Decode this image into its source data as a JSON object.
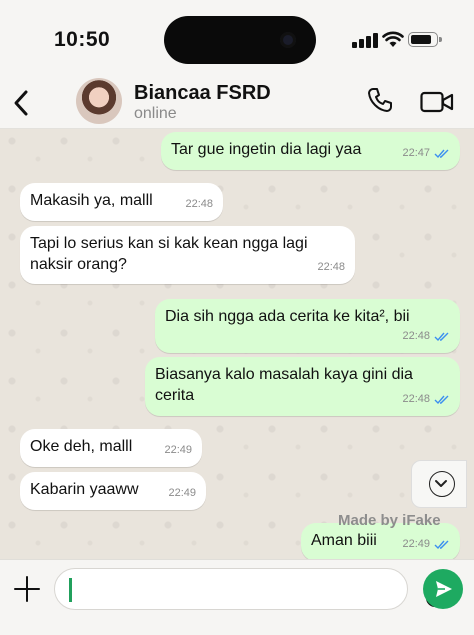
{
  "status_bar": {
    "time": "10:50"
  },
  "header": {
    "contact_name": "Biancaa FSRD",
    "contact_status": "online"
  },
  "messages": [
    {
      "direction": "out",
      "text": "Tar gue ingetin dia lagi yaa",
      "time": "22:47",
      "read": true
    },
    {
      "direction": "in",
      "text": "Makasih ya, malll",
      "time": "22:48"
    },
    {
      "direction": "in",
      "text": "Tapi lo serius kan si kak kean ngga lagi naksir orang?",
      "time": "22:48"
    },
    {
      "direction": "out",
      "text": "Dia sih ngga ada cerita ke kita², bii",
      "time": "22:48",
      "read": true
    },
    {
      "direction": "out",
      "text": "Biasanya kalo masalah kaya gini dia cerita",
      "time": "22:48",
      "read": true
    },
    {
      "direction": "in",
      "text": "Oke deh, malll",
      "time": "22:49"
    },
    {
      "direction": "in",
      "text": "Kabarin yaaww",
      "time": "22:49"
    },
    {
      "direction": "out",
      "text": "Aman biii",
      "time": "22:49",
      "read": true
    }
  ],
  "watermark": "Made by iFake",
  "composer": {
    "value": "",
    "placeholder": ""
  },
  "colors": {
    "outgoing_bubble": "#d9fdd3",
    "incoming_bubble": "#ffffff",
    "read_tick": "#3b8ff0",
    "send_button": "#1eaa61"
  },
  "icons": [
    "back-chevron-icon",
    "phone-icon",
    "video-camera-icon",
    "scroll-down-icon",
    "plus-icon",
    "sticker-icon",
    "send-icon",
    "double-check-icon"
  ]
}
